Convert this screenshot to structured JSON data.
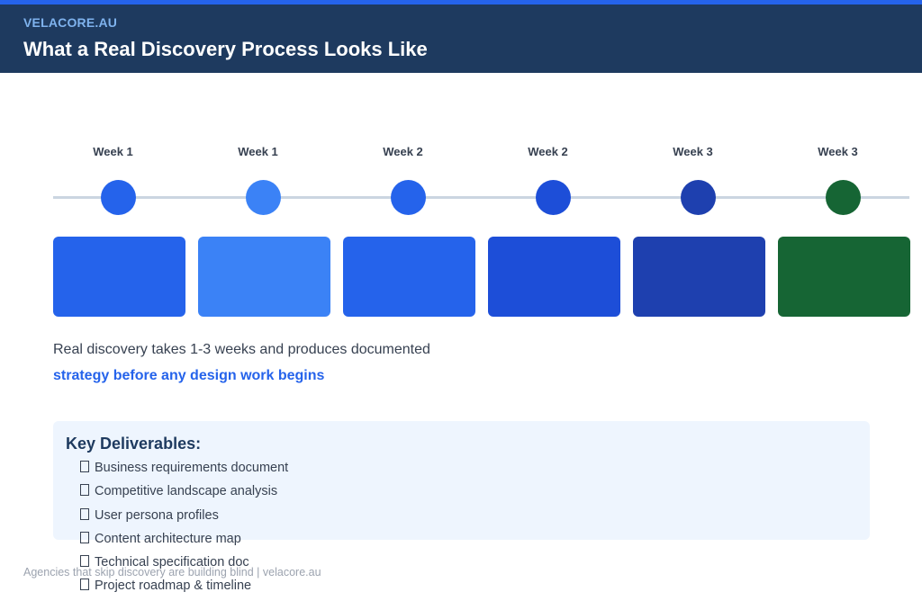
{
  "header": {
    "brand": "VELACORE.AU",
    "title": "What a Real Discovery Process Looks Like"
  },
  "timeline": {
    "steps": [
      {
        "week": "Week 1",
        "color": "#2563eb"
      },
      {
        "week": "Week 1",
        "color": "#3b82f6"
      },
      {
        "week": "Week 2",
        "color": "#2563eb"
      },
      {
        "week": "Week 2",
        "color": "#1d4ed8"
      },
      {
        "week": "Week 3",
        "color": "#1e40af"
      },
      {
        "week": "Week 3",
        "color": "#166534"
      }
    ]
  },
  "summary": {
    "line1": "Real discovery takes 1-3 weeks and produces documented",
    "line2": "strategy before any design work begins"
  },
  "deliverables": {
    "title": "Key Deliverables:",
    "items": [
      "Business requirements document",
      "Competitive landscape analysis",
      "User persona profiles",
      "Content architecture map",
      "Technical specification doc",
      "Project roadmap & timeline"
    ]
  },
  "footer": {
    "text": "Agencies that skip discovery are building blind  |  velacore.au"
  },
  "colors": {
    "header_bg": "#1e3a5f",
    "top_accent": "#2563eb",
    "brand": "#7fb3ee",
    "panel_bg": "#eef5fe"
  }
}
